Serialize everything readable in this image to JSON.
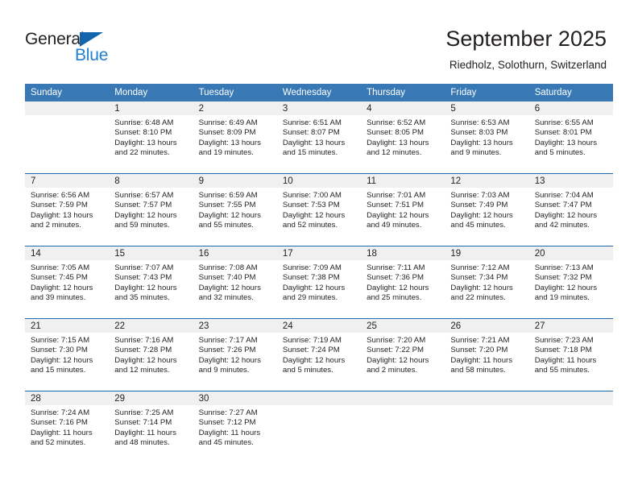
{
  "brand": {
    "name_part1": "General",
    "name_part2": "Blue",
    "triangle_color": "#1264ab",
    "blue_color": "#1f7fd0"
  },
  "header": {
    "title": "September 2025",
    "subtitle": "Riedholz, Solothurn, Switzerland"
  },
  "theme": {
    "header_bg": "#3878b4",
    "row_border": "#1e6bad",
    "daynum_bg": "#f0f0f0",
    "text": "#231f20"
  },
  "weekdays": [
    "Sunday",
    "Monday",
    "Tuesday",
    "Wednesday",
    "Thursday",
    "Friday",
    "Saturday"
  ],
  "weeks": [
    [
      {
        "day": "",
        "sunrise": "",
        "sunset": "",
        "daylight1": "",
        "daylight2": ""
      },
      {
        "day": "1",
        "sunrise": "Sunrise: 6:48 AM",
        "sunset": "Sunset: 8:10 PM",
        "daylight1": "Daylight: 13 hours",
        "daylight2": "and 22 minutes."
      },
      {
        "day": "2",
        "sunrise": "Sunrise: 6:49 AM",
        "sunset": "Sunset: 8:09 PM",
        "daylight1": "Daylight: 13 hours",
        "daylight2": "and 19 minutes."
      },
      {
        "day": "3",
        "sunrise": "Sunrise: 6:51 AM",
        "sunset": "Sunset: 8:07 PM",
        "daylight1": "Daylight: 13 hours",
        "daylight2": "and 15 minutes."
      },
      {
        "day": "4",
        "sunrise": "Sunrise: 6:52 AM",
        "sunset": "Sunset: 8:05 PM",
        "daylight1": "Daylight: 13 hours",
        "daylight2": "and 12 minutes."
      },
      {
        "day": "5",
        "sunrise": "Sunrise: 6:53 AM",
        "sunset": "Sunset: 8:03 PM",
        "daylight1": "Daylight: 13 hours",
        "daylight2": "and 9 minutes."
      },
      {
        "day": "6",
        "sunrise": "Sunrise: 6:55 AM",
        "sunset": "Sunset: 8:01 PM",
        "daylight1": "Daylight: 13 hours",
        "daylight2": "and 5 minutes."
      }
    ],
    [
      {
        "day": "7",
        "sunrise": "Sunrise: 6:56 AM",
        "sunset": "Sunset: 7:59 PM",
        "daylight1": "Daylight: 13 hours",
        "daylight2": "and 2 minutes."
      },
      {
        "day": "8",
        "sunrise": "Sunrise: 6:57 AM",
        "sunset": "Sunset: 7:57 PM",
        "daylight1": "Daylight: 12 hours",
        "daylight2": "and 59 minutes."
      },
      {
        "day": "9",
        "sunrise": "Sunrise: 6:59 AM",
        "sunset": "Sunset: 7:55 PM",
        "daylight1": "Daylight: 12 hours",
        "daylight2": "and 55 minutes."
      },
      {
        "day": "10",
        "sunrise": "Sunrise: 7:00 AM",
        "sunset": "Sunset: 7:53 PM",
        "daylight1": "Daylight: 12 hours",
        "daylight2": "and 52 minutes."
      },
      {
        "day": "11",
        "sunrise": "Sunrise: 7:01 AM",
        "sunset": "Sunset: 7:51 PM",
        "daylight1": "Daylight: 12 hours",
        "daylight2": "and 49 minutes."
      },
      {
        "day": "12",
        "sunrise": "Sunrise: 7:03 AM",
        "sunset": "Sunset: 7:49 PM",
        "daylight1": "Daylight: 12 hours",
        "daylight2": "and 45 minutes."
      },
      {
        "day": "13",
        "sunrise": "Sunrise: 7:04 AM",
        "sunset": "Sunset: 7:47 PM",
        "daylight1": "Daylight: 12 hours",
        "daylight2": "and 42 minutes."
      }
    ],
    [
      {
        "day": "14",
        "sunrise": "Sunrise: 7:05 AM",
        "sunset": "Sunset: 7:45 PM",
        "daylight1": "Daylight: 12 hours",
        "daylight2": "and 39 minutes."
      },
      {
        "day": "15",
        "sunrise": "Sunrise: 7:07 AM",
        "sunset": "Sunset: 7:43 PM",
        "daylight1": "Daylight: 12 hours",
        "daylight2": "and 35 minutes."
      },
      {
        "day": "16",
        "sunrise": "Sunrise: 7:08 AM",
        "sunset": "Sunset: 7:40 PM",
        "daylight1": "Daylight: 12 hours",
        "daylight2": "and 32 minutes."
      },
      {
        "day": "17",
        "sunrise": "Sunrise: 7:09 AM",
        "sunset": "Sunset: 7:38 PM",
        "daylight1": "Daylight: 12 hours",
        "daylight2": "and 29 minutes."
      },
      {
        "day": "18",
        "sunrise": "Sunrise: 7:11 AM",
        "sunset": "Sunset: 7:36 PM",
        "daylight1": "Daylight: 12 hours",
        "daylight2": "and 25 minutes."
      },
      {
        "day": "19",
        "sunrise": "Sunrise: 7:12 AM",
        "sunset": "Sunset: 7:34 PM",
        "daylight1": "Daylight: 12 hours",
        "daylight2": "and 22 minutes."
      },
      {
        "day": "20",
        "sunrise": "Sunrise: 7:13 AM",
        "sunset": "Sunset: 7:32 PM",
        "daylight1": "Daylight: 12 hours",
        "daylight2": "and 19 minutes."
      }
    ],
    [
      {
        "day": "21",
        "sunrise": "Sunrise: 7:15 AM",
        "sunset": "Sunset: 7:30 PM",
        "daylight1": "Daylight: 12 hours",
        "daylight2": "and 15 minutes."
      },
      {
        "day": "22",
        "sunrise": "Sunrise: 7:16 AM",
        "sunset": "Sunset: 7:28 PM",
        "daylight1": "Daylight: 12 hours",
        "daylight2": "and 12 minutes."
      },
      {
        "day": "23",
        "sunrise": "Sunrise: 7:17 AM",
        "sunset": "Sunset: 7:26 PM",
        "daylight1": "Daylight: 12 hours",
        "daylight2": "and 9 minutes."
      },
      {
        "day": "24",
        "sunrise": "Sunrise: 7:19 AM",
        "sunset": "Sunset: 7:24 PM",
        "daylight1": "Daylight: 12 hours",
        "daylight2": "and 5 minutes."
      },
      {
        "day": "25",
        "sunrise": "Sunrise: 7:20 AM",
        "sunset": "Sunset: 7:22 PM",
        "daylight1": "Daylight: 12 hours",
        "daylight2": "and 2 minutes."
      },
      {
        "day": "26",
        "sunrise": "Sunrise: 7:21 AM",
        "sunset": "Sunset: 7:20 PM",
        "daylight1": "Daylight: 11 hours",
        "daylight2": "and 58 minutes."
      },
      {
        "day": "27",
        "sunrise": "Sunrise: 7:23 AM",
        "sunset": "Sunset: 7:18 PM",
        "daylight1": "Daylight: 11 hours",
        "daylight2": "and 55 minutes."
      }
    ],
    [
      {
        "day": "28",
        "sunrise": "Sunrise: 7:24 AM",
        "sunset": "Sunset: 7:16 PM",
        "daylight1": "Daylight: 11 hours",
        "daylight2": "and 52 minutes."
      },
      {
        "day": "29",
        "sunrise": "Sunrise: 7:25 AM",
        "sunset": "Sunset: 7:14 PM",
        "daylight1": "Daylight: 11 hours",
        "daylight2": "and 48 minutes."
      },
      {
        "day": "30",
        "sunrise": "Sunrise: 7:27 AM",
        "sunset": "Sunset: 7:12 PM",
        "daylight1": "Daylight: 11 hours",
        "daylight2": "and 45 minutes."
      },
      {
        "day": "",
        "sunrise": "",
        "sunset": "",
        "daylight1": "",
        "daylight2": ""
      },
      {
        "day": "",
        "sunrise": "",
        "sunset": "",
        "daylight1": "",
        "daylight2": ""
      },
      {
        "day": "",
        "sunrise": "",
        "sunset": "",
        "daylight1": "",
        "daylight2": ""
      },
      {
        "day": "",
        "sunrise": "",
        "sunset": "",
        "daylight1": "",
        "daylight2": ""
      }
    ]
  ]
}
